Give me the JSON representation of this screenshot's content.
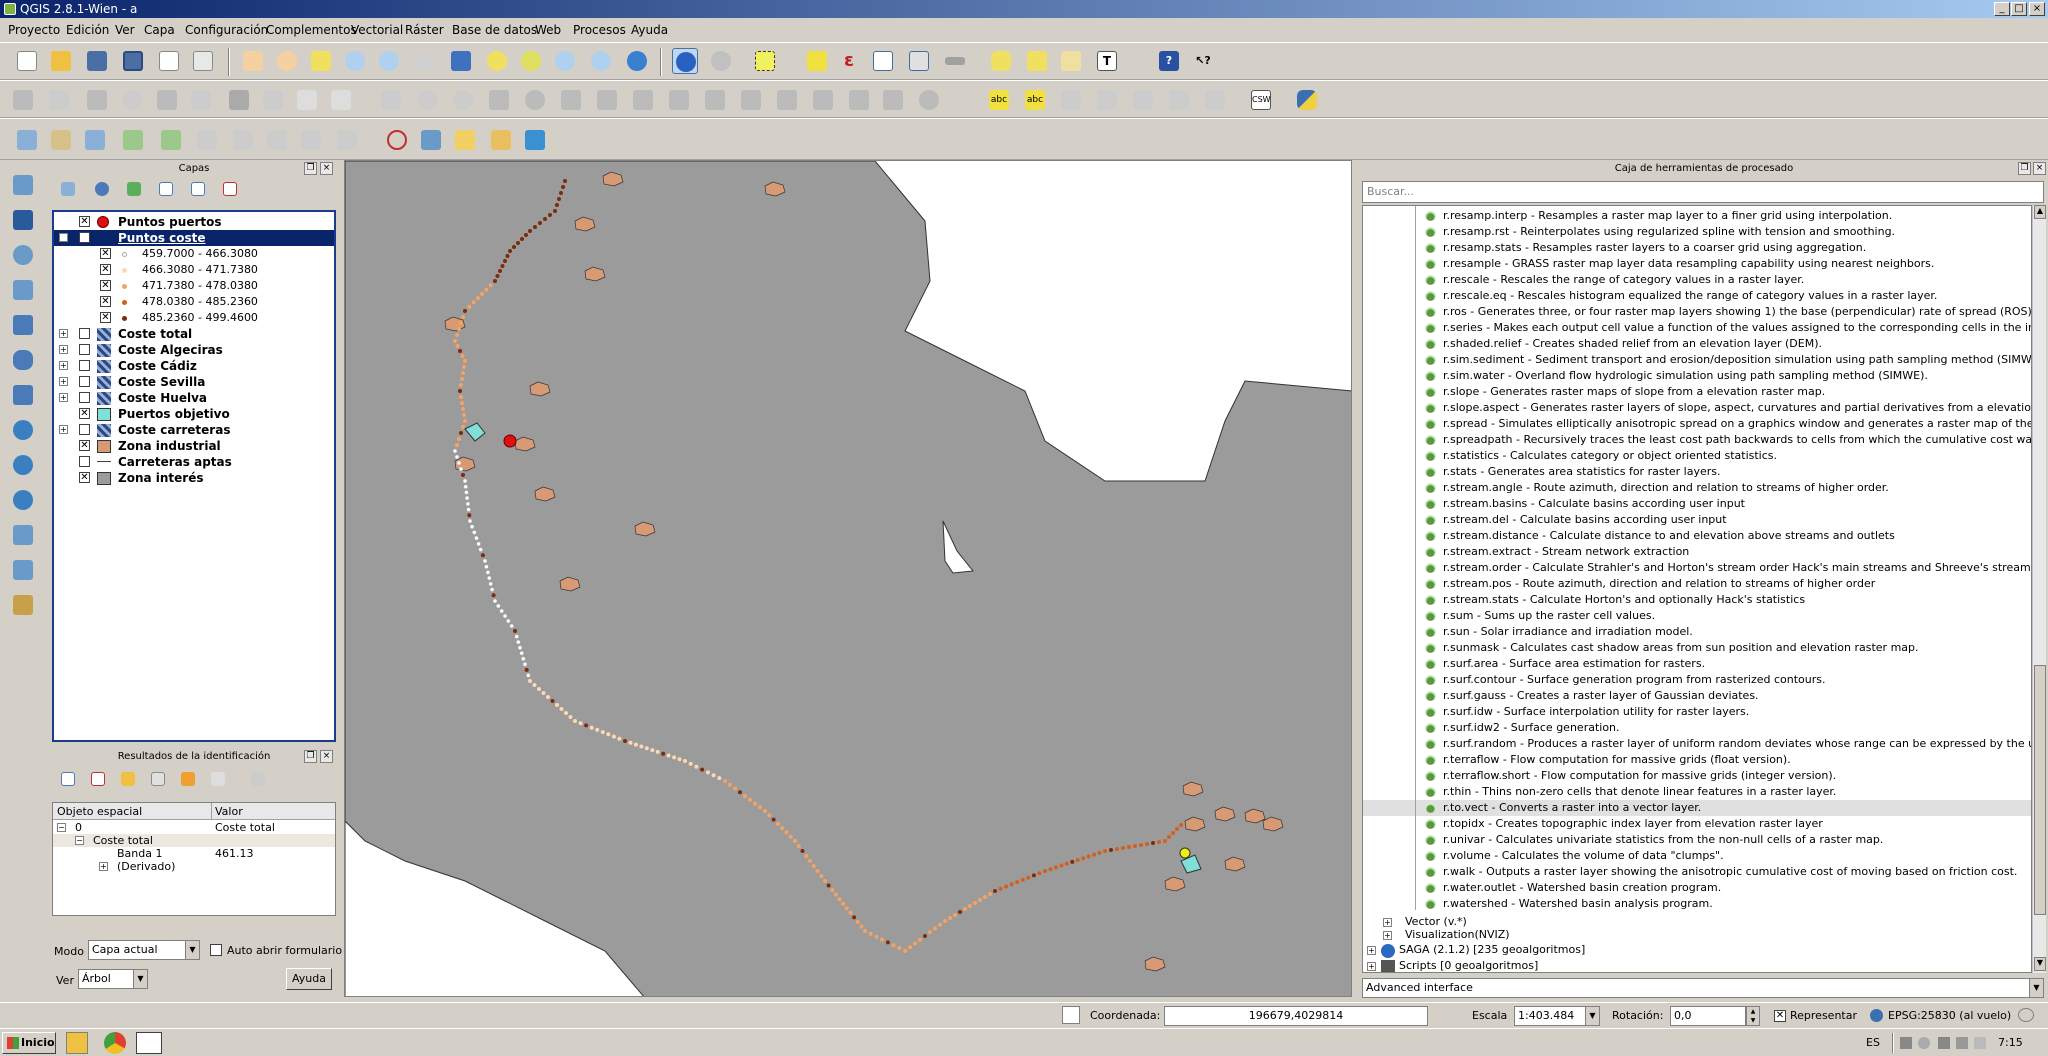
{
  "window": {
    "title": "QGIS 2.8.1-Wien - a",
    "minimize": "_",
    "maximize": "□",
    "close": "×"
  },
  "menu": [
    "Proyecto",
    "Edición",
    "Ver",
    "Capa",
    "Configuración",
    "Complementos",
    "Vectorial",
    "Ráster",
    "Base de datos",
    "Web",
    "Procesos",
    "Ayuda"
  ],
  "layers_panel": {
    "title": "Capas",
    "items": [
      {
        "name": "Puntos puertos",
        "checked": true,
        "symbol": "red-dot"
      },
      {
        "name": "Puntos coste",
        "checked": true,
        "selected": true,
        "expanded": true
      },
      {
        "name": "459.7000 - 466.3080",
        "class": true,
        "color": "#ffffff"
      },
      {
        "name": "466.3080 - 471.7380",
        "class": true,
        "color": "#fcd9b3"
      },
      {
        "name": "471.7380 - 478.0380",
        "class": true,
        "color": "#f4a364"
      },
      {
        "name": "478.0380 - 485.2360",
        "class": true,
        "color": "#d2601c"
      },
      {
        "name": "485.2360 - 499.4600",
        "class": true,
        "color": "#7a2c0c"
      },
      {
        "name": "Coste total",
        "checked": false,
        "symbol": "raster"
      },
      {
        "name": "Coste Algeciras",
        "checked": false,
        "symbol": "raster"
      },
      {
        "name": "Coste Cádiz",
        "checked": false,
        "symbol": "raster"
      },
      {
        "name": "Coste Sevilla",
        "checked": false,
        "symbol": "raster"
      },
      {
        "name": "Coste Huelva",
        "checked": false,
        "symbol": "raster"
      },
      {
        "name": "Puertos objetivo",
        "checked": true,
        "symbol": "cyan-poly"
      },
      {
        "name": "Coste carreteras",
        "checked": false,
        "symbol": "raster"
      },
      {
        "name": "Zona industrial",
        "checked": true,
        "symbol": "tan-poly"
      },
      {
        "name": "Carreteras aptas",
        "checked": false,
        "symbol": "line"
      },
      {
        "name": "Zona interés",
        "checked": true,
        "symbol": "gray-poly"
      }
    ]
  },
  "identify_panel": {
    "title": "Resultados de la identificación",
    "col_feature": "Objeto espacial",
    "col_value": "Valor",
    "rows": [
      {
        "a": "0",
        "b": "Coste total"
      },
      {
        "a": "Coste total",
        "b": ""
      },
      {
        "a": "Banda 1",
        "b": "461.13"
      },
      {
        "a": "(Derivado)",
        "b": ""
      }
    ],
    "mode_label": "Modo",
    "mode_value": "Capa actual",
    "auto_open": "Auto abrir formulario",
    "view_label": "Ver",
    "view_value": "Árbol",
    "help": "Ayuda"
  },
  "processing": {
    "title": "Caja de herramientas de procesado",
    "search_placeholder": "Buscar...",
    "algorithms": [
      "r.resamp.interp - Resamples a raster map layer to a finer grid using interpolation.",
      "r.resamp.rst - Reinterpolates using regularized spline with tension and smoothing.",
      "r.resamp.stats - Resamples raster layers to a coarser grid using aggregation.",
      "r.resample - GRASS raster map layer data resampling capability using nearest neighbors.",
      "r.rescale - Rescales the range of category values in a raster layer.",
      "r.rescale.eq - Rescales histogram equalized the range of category values in a raster  layer.",
      "r.ros - Generates three, or four raster map layers showing 1) the base (perpendicular) rate of spread (ROS), 2) the ma...",
      "r.series - Makes each output cell value a function of the values assigned to the corresponding cells in the input raster la...",
      "r.shaded.relief - Creates shaded relief from an elevation layer (DEM).",
      "r.sim.sediment - Sediment transport and erosion/deposition simulation using path sampling method (SIMWE).",
      "r.sim.water - Overland flow hydrologic simulation using path sampling method (SIMWE).",
      "r.slope - Generates raster maps of slope from a elevation raster map.",
      "r.slope.aspect - Generates raster layers of slope, aspect, curvatures and partial derivatives from a elevation raster layer.",
      "r.spread - Simulates elliptically anisotropic spread on a graphics window and generates a raster map of the cumulative ti...",
      "r.spreadpath - Recursively traces the least cost path backwards to cells from which the cumulative cost was determined.",
      "r.statistics - Calculates category or object oriented statistics.",
      "r.stats - Generates area statistics for raster layers.",
      "r.stream.angle - Route azimuth, direction and relation to streams of higher order.",
      "r.stream.basins - Calculate basins according user input",
      "r.stream.del - Calculate basins according user input",
      "r.stream.distance - Calculate distance to and elevation above streams and outlets",
      "r.stream.extract - Stream network extraction",
      "r.stream.order - Calculate Strahler's and Horton's stream order Hack's main streams and Shreeve's stream magnitude",
      "r.stream.pos - Route azimuth, direction and relation to streams of higher order",
      "r.stream.stats - Calculate Horton's and optionally Hack's statistics",
      "r.sum - Sums up the raster cell values.",
      "r.sun - Solar irradiance and irradiation model.",
      "r.sunmask - Calculates cast shadow areas from sun position and elevation raster map.",
      "r.surf.area - Surface area estimation for rasters.",
      "r.surf.contour - Surface generation program from rasterized contours.",
      "r.surf.gauss - Creates a raster layer of Gaussian deviates.",
      "r.surf.idw - Surface interpolation utility for raster layers.",
      "r.surf.idw2 - Surface generation.",
      "r.surf.random - Produces a raster layer of uniform random deviates whose range can be expressed by the user.",
      "r.terraflow - Flow computation for massive grids (float version).",
      "r.terraflow.short - Flow computation for massive grids (integer version).",
      "r.thin - Thins non-zero cells that denote linear features in a raster layer.",
      "r.to.vect - Converts a raster into a vector layer.",
      "r.topidx - Creates topographic index layer from elevation raster layer",
      "r.univar - Calculates univariate statistics from the non-null cells of a raster map.",
      "r.volume - Calculates the volume of data \"clumps\".",
      "r.walk - Outputs a raster layer showing the anisotropic cumulative cost of moving based on friction cost.",
      "r.water.outlet - Watershed basin creation program.",
      "r.watershed - Watershed basin analysis program."
    ],
    "selected_index": 37,
    "groups": [
      "Vector (v.*)",
      "Visualization(NVIZ)",
      "SAGA (2.1.2) [235 geoalgoritmos]",
      "Scripts [0 geoalgoritmos]"
    ],
    "advanced": "Advanced interface"
  },
  "status": {
    "coord_label": "Coordenada:",
    "coord_value": "196679,4029814",
    "scale_label": "Escala",
    "scale_value": "1:403.484",
    "rotation_label": "Rotación:",
    "rotation_value": "0,0",
    "render_label": "Representar",
    "crs": "EPSG:25830 (al vuelo)"
  },
  "taskbar": {
    "start": "Inicio",
    "lang": "ES",
    "time": "7:15"
  },
  "colors": {
    "gray_zone": "#9b9b9b",
    "path_light": "#ffffff",
    "path_mid": "#f4a364",
    "path_dark": "#7a2c0c"
  }
}
